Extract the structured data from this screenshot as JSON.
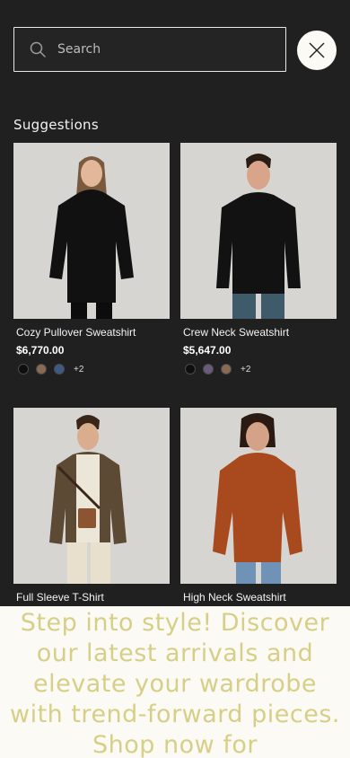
{
  "search": {
    "placeholder": "Search"
  },
  "suggestions": {
    "title": "Suggestions",
    "products": [
      {
        "name": "Cozy Pullover Sweatshirt",
        "price": "$6,770.00",
        "swatches": [
          "#0e0e0e",
          "#8a6a52",
          "#3d5a84"
        ],
        "more": "+2"
      },
      {
        "name": "Crew Neck Sweatshirt",
        "price": "$5,647.00",
        "swatches": [
          "#0e0e0e",
          "#6b5b7d",
          "#8a6a52"
        ],
        "more": "+2"
      },
      {
        "name": "Full Sleeve T-Shirt"
      },
      {
        "name": "High Neck Sweatshirt"
      }
    ]
  },
  "banner": {
    "text": "Step into style! Discover our latest arrivals and elevate your wardrobe with trend-forward pieces. Shop now for"
  }
}
